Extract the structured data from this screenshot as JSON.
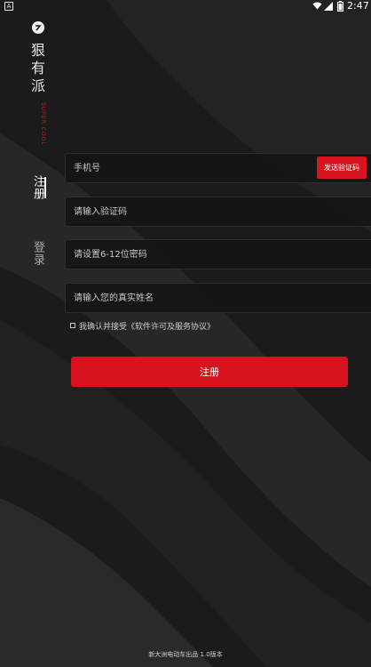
{
  "status_bar": {
    "notification": "A",
    "time": "2:47"
  },
  "brand": {
    "name": [
      "狠",
      "有",
      "派"
    ],
    "tagline": "SUPER COOL"
  },
  "tabs": {
    "register": "注册",
    "login": "登录"
  },
  "form": {
    "phone_placeholder": "手机号",
    "send_code_label": "发送验证码",
    "code_placeholder": "请输入验证码",
    "password_placeholder": "请设置6-12位密码",
    "name_placeholder": "请输入您的真实姓名",
    "agreement_text": "我确认并接受《软件许可及服务协议》",
    "submit_label": "注册"
  },
  "footer": {
    "text": "新大洲电动车出品 1.0版本"
  },
  "colors": {
    "accent": "#d7131e",
    "background": "#1d1d1d"
  }
}
